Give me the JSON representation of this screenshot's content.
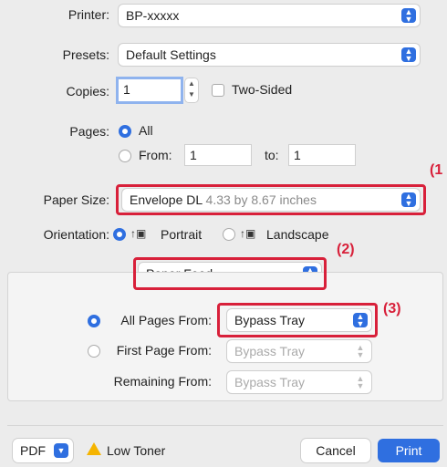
{
  "printer": {
    "label": "Printer:",
    "value": "BP-xxxxx"
  },
  "presets": {
    "label": "Presets:",
    "value": "Default Settings"
  },
  "copies": {
    "label": "Copies:",
    "value": "1",
    "two_sided": "Two-Sided"
  },
  "pages": {
    "label": "Pages:",
    "all": "All",
    "from": "From:",
    "from_value": "1",
    "to": "to:",
    "to_value": "1"
  },
  "paper_size": {
    "label": "Paper Size:",
    "value": "Envelope DL",
    "dims": "4.33 by 8.67 inches"
  },
  "orientation": {
    "label": "Orientation:",
    "portrait": "Portrait",
    "landscape": "Landscape"
  },
  "section_popup": {
    "value": "Paper Feed"
  },
  "paper_feed": {
    "all_pages_from": "All Pages From:",
    "all_pages_value": "Bypass Tray",
    "first_page_from": "First Page From:",
    "first_page_value": "Bypass Tray",
    "remaining_from": "Remaining From:",
    "remaining_value": "Bypass Tray"
  },
  "footer": {
    "pdf": "PDF",
    "warning": "Low Toner",
    "cancel": "Cancel",
    "print": "Print"
  },
  "callouts": {
    "c1": "(1",
    "c2": "(2)",
    "c3": "(3)"
  },
  "colors": {
    "accent": "#2f6fe0",
    "callout_red": "#d8203a",
    "warning_yellow": "#f5b400"
  }
}
